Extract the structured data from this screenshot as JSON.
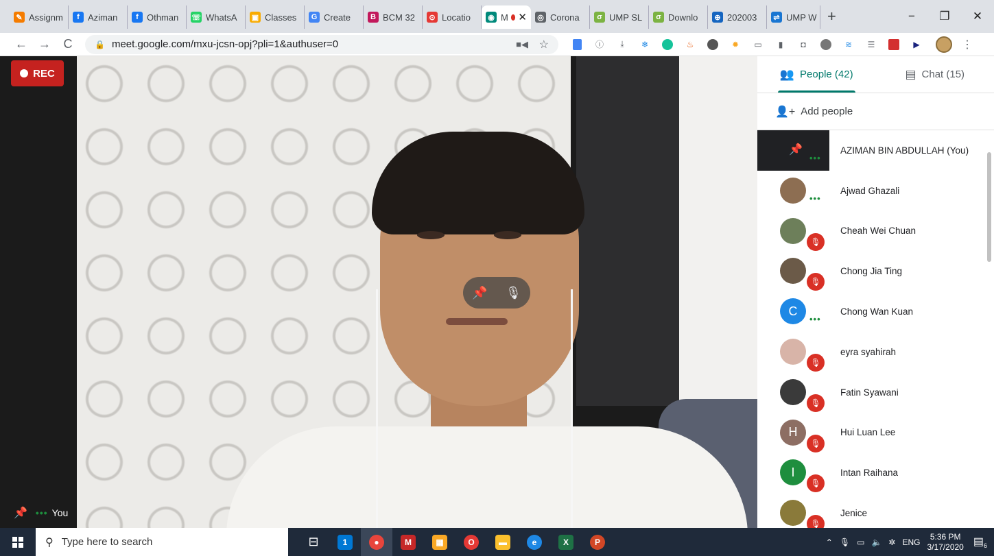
{
  "browser": {
    "tabs": [
      {
        "label": "Assignm",
        "icon": "moodle-icon",
        "color": "#f57c00",
        "glyph": "✎"
      },
      {
        "label": "Aziman",
        "icon": "facebook-icon",
        "color": "#1877f2",
        "glyph": "f"
      },
      {
        "label": "Othman",
        "icon": "facebook-icon",
        "color": "#1877f2",
        "glyph": "f"
      },
      {
        "label": "WhatsA",
        "icon": "whatsapp-icon",
        "color": "#25d366",
        "glyph": "☏"
      },
      {
        "label": "Classes",
        "icon": "classroom-icon",
        "color": "#f9ab00",
        "glyph": "▣"
      },
      {
        "label": "Create",
        "icon": "google-icon",
        "color": "#4285f4",
        "glyph": "G"
      },
      {
        "label": "BCM 32",
        "icon": "bcm-icon",
        "color": "#c2185b",
        "glyph": "B"
      },
      {
        "label": "Locatio",
        "icon": "location-icon",
        "color": "#e53935",
        "glyph": "⊙"
      },
      {
        "label": "M",
        "icon": "meet-icon",
        "color": "#00897b",
        "glyph": "◉",
        "active": true
      },
      {
        "label": "Corona",
        "icon": "web-icon",
        "color": "#5f6368",
        "glyph": "◎"
      },
      {
        "label": "UMP SL",
        "icon": "ump-icon",
        "color": "#7cb342",
        "glyph": "σ"
      },
      {
        "label": "Downlo",
        "icon": "ump-icon",
        "color": "#7cb342",
        "glyph": "σ"
      },
      {
        "label": "202003",
        "icon": "who-icon",
        "color": "#1565c0",
        "glyph": "⊕"
      },
      {
        "label": "UMP W",
        "icon": "ump-web-icon",
        "color": "#1976d2",
        "glyph": "⇌"
      }
    ],
    "new_tab_glyph": "+",
    "window_controls": {
      "minimize": "−",
      "maximize": "❐",
      "close": "✕"
    },
    "url": "meet.google.com/mxu-jcsn-opj?pli=1&authuser=0"
  },
  "meeting": {
    "rec_label": "REC",
    "self_label": "You",
    "self_dots": "•••"
  },
  "panel": {
    "people_tab": "People (42)",
    "chat_tab": "Chat (15)",
    "add_people": "Add people",
    "participants": [
      {
        "name": "AZIMAN BIN ABDULLAH (You)",
        "status": "speaking",
        "avatar_color": "#202124",
        "initial": "",
        "you": true
      },
      {
        "name": "Ajwad Ghazali",
        "status": "speaking",
        "avatar_color": "#8d6e52",
        "initial": ""
      },
      {
        "name": "Cheah Wei Chuan",
        "status": "muted",
        "avatar_color": "#6d7f5a",
        "initial": ""
      },
      {
        "name": "Chong Jia Ting",
        "status": "muted",
        "avatar_color": "#6b5a48",
        "initial": ""
      },
      {
        "name": "Chong Wan Kuan",
        "status": "speaking",
        "avatar_color": "#1e88e5",
        "initial": "C"
      },
      {
        "name": "eyra syahirah",
        "status": "muted",
        "avatar_color": "#d8b4a8",
        "initial": ""
      },
      {
        "name": "Fatin Syawani",
        "status": "muted",
        "avatar_color": "#3a3a3a",
        "initial": ""
      },
      {
        "name": "Hui Luan Lee",
        "status": "muted",
        "avatar_color": "#8d6e63",
        "initial": "H"
      },
      {
        "name": "Intan Raihana",
        "status": "muted",
        "avatar_color": "#1e8e3e",
        "initial": "I"
      },
      {
        "name": "Jenice",
        "status": "muted",
        "avatar_color": "#8a7a3a",
        "initial": ""
      }
    ]
  },
  "taskbar": {
    "search_placeholder": "Type here to search",
    "language": "ENG",
    "time": "5:36 PM",
    "date": "3/17/2020",
    "notification_count": "6",
    "mail_badge": "1"
  }
}
